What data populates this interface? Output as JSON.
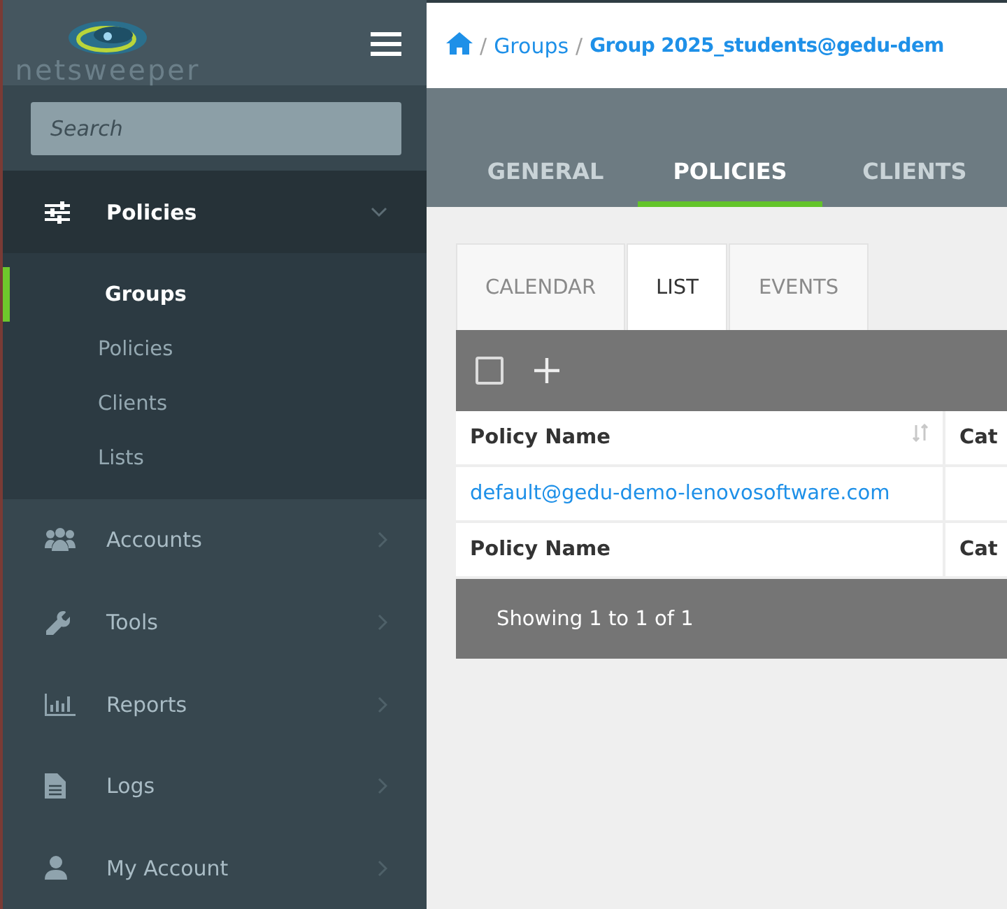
{
  "logo": {
    "text": "netsweeper"
  },
  "search": {
    "placeholder": "Search"
  },
  "nav": [
    {
      "label": "Policies",
      "expanded": true,
      "children": [
        {
          "label": "Groups",
          "selected": true
        },
        {
          "label": "Policies",
          "selected": false
        },
        {
          "label": "Clients",
          "selected": false
        },
        {
          "label": "Lists",
          "selected": false
        }
      ]
    },
    {
      "label": "Accounts",
      "expanded": false
    },
    {
      "label": "Tools",
      "expanded": false
    },
    {
      "label": "Reports",
      "expanded": false
    },
    {
      "label": "Logs",
      "expanded": false
    },
    {
      "label": "My Account",
      "expanded": false
    }
  ],
  "breadcrumb": [
    {
      "separator": "/",
      "label": "Groups",
      "current": false
    },
    {
      "separator": "/",
      "label": "Group 2025_students@gedu-dem",
      "current": true
    }
  ],
  "tabs": [
    {
      "label": "GENERAL",
      "selected": false
    },
    {
      "label": "POLICIES",
      "selected": true
    },
    {
      "label": "CLIENTS",
      "selected": false
    }
  ],
  "subtabs": [
    {
      "label": "CALENDAR",
      "selected": false
    },
    {
      "label": "LIST",
      "selected": true
    },
    {
      "label": "EVENTS",
      "selected": false
    }
  ],
  "table": {
    "select_all_checked": false,
    "columns": [
      "Policy Name",
      "Cat"
    ],
    "rows": [
      {
        "policy_name": "default@gedu-demo-lenovosoftware.com"
      }
    ],
    "footer_columns": [
      "Policy Name",
      "Cat"
    ],
    "info": "Showing 1 to 1 of 1"
  }
}
